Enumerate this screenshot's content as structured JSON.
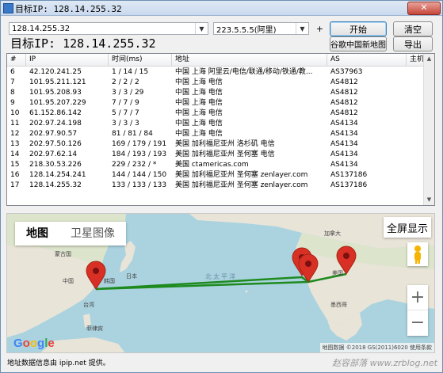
{
  "window": {
    "title": "目标IP: 128.14.255.32"
  },
  "toolbar": {
    "target_input_value": "128.14.255.32",
    "dns_select_value": "223.5.5.5(阿里)",
    "plus_label": "+",
    "start_label": "开始",
    "clear_label": "清空",
    "google_map_label": "谷歌中国新地图",
    "export_label": "导出"
  },
  "target_label": "目标IP: 128.14.255.32",
  "table": {
    "columns": [
      "#",
      "IP",
      "时间(ms)",
      "地址",
      "AS",
      "主机"
    ],
    "rows": [
      [
        "6",
        "42.120.241.25",
        "1 / 14 / 15",
        "中国 上海 阿里云/电信/联通/移动/铁通/教...",
        "AS37963",
        ""
      ],
      [
        "7",
        "101.95.211.121",
        "2 / 2 / 2",
        "中国 上海 电信",
        "AS4812",
        ""
      ],
      [
        "8",
        "101.95.208.93",
        "3 / 3 / 29",
        "中国 上海 电信",
        "AS4812",
        ""
      ],
      [
        "9",
        "101.95.207.229",
        "7 / 7 / 9",
        "中国 上海 电信",
        "AS4812",
        ""
      ],
      [
        "10",
        "61.152.86.142",
        "5 / 7 / 7",
        "中国 上海 电信",
        "AS4812",
        ""
      ],
      [
        "11",
        "202.97.24.198",
        "3 / 3 / 3",
        "中国 上海 电信",
        "AS4134",
        ""
      ],
      [
        "12",
        "202.97.90.57",
        "81 / 81 / 84",
        "中国 上海 电信",
        "AS4134",
        ""
      ],
      [
        "13",
        "202.97.50.126",
        "169 / 179 / 191",
        "美国 加利福尼亚州 洛杉矶 电信",
        "AS4134",
        ""
      ],
      [
        "14",
        "202.97.62.14",
        "184 / 193 / 193",
        "美国 加利福尼亚州 圣何塞 电信",
        "AS4134",
        ""
      ],
      [
        "15",
        "218.30.53.226",
        "229 / 232 / *",
        "美国 ctamericas.com",
        "AS4134",
        ""
      ],
      [
        "16",
        "128.14.254.241",
        "144 / 144 / 150",
        "美国 加利福尼亚州 圣何塞 zenlayer.com",
        "AS137186",
        ""
      ],
      [
        "17",
        "128.14.255.32",
        "133 / 133 / 133",
        "美国 加利福尼亚州 圣何塞 zenlayer.com",
        "AS137186",
        ""
      ]
    ]
  },
  "map": {
    "type_map_label": "地图",
    "type_satellite_label": "卫星图像",
    "fullscreen_label": "全屏显示",
    "zoom_in_label": "+",
    "zoom_out_label": "−",
    "labels": {
      "mongolia": "蒙古国",
      "china": "中国",
      "korea": "韩国",
      "japan": "日本",
      "taiwan": "台湾",
      "philippines": "菲律宾",
      "pacific": "北太平洋",
      "usa": "美国",
      "mexico": "墨西哥",
      "canada": "加拿大"
    },
    "google_logo": "Google",
    "attribution": "地图数据 ©2018 GS(2011)6020  使用条款",
    "accent_route": "#1e8a1e",
    "marker_color": "#d93025"
  },
  "footer": "地址数据信息由 ipip.net 提供。",
  "watermark": "赵容部落 www.zrblog.net"
}
